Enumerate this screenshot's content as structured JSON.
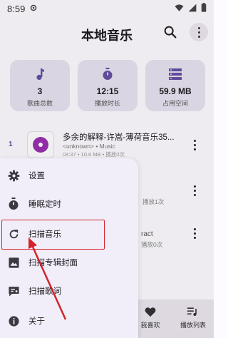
{
  "status_bar": {
    "time": "8:59"
  },
  "header": {
    "title": "本地音乐"
  },
  "stats": [
    {
      "icon": "music-note-icon",
      "value": "3",
      "label": "歌曲总数"
    },
    {
      "icon": "stopwatch-icon",
      "value": "12:15",
      "label": "播放时长"
    },
    {
      "icon": "storage-icon",
      "value": "59.9 MB",
      "label": "占用空间"
    }
  ],
  "songs": [
    {
      "index": "1",
      "title": "多余的解释-许嵩-薄荷音乐35...",
      "subtitle": "<unknown> • Music",
      "meta": "04:37 • 10.6 MB • 播放0次"
    }
  ],
  "partial_rows": [
    "播放1次",
    "ract",
    "播放0次"
  ],
  "menu": [
    {
      "icon": "gear-icon",
      "label": "设置"
    },
    {
      "icon": "timer-icon",
      "label": "睡眠定时"
    },
    {
      "icon": "refresh-icon",
      "label": "扫描音乐"
    },
    {
      "icon": "image-icon",
      "label": "扫描专辑封面"
    },
    {
      "icon": "lyrics-icon",
      "label": "扫描歌词"
    },
    {
      "icon": "info-icon",
      "label": "关于"
    }
  ],
  "bottom_nav": {
    "favorites": "我喜欢",
    "playlist": "播放列表"
  },
  "colors": {
    "accent": "#6750a4",
    "annotation": "#d2232a",
    "disc": "#9b2fb2"
  }
}
